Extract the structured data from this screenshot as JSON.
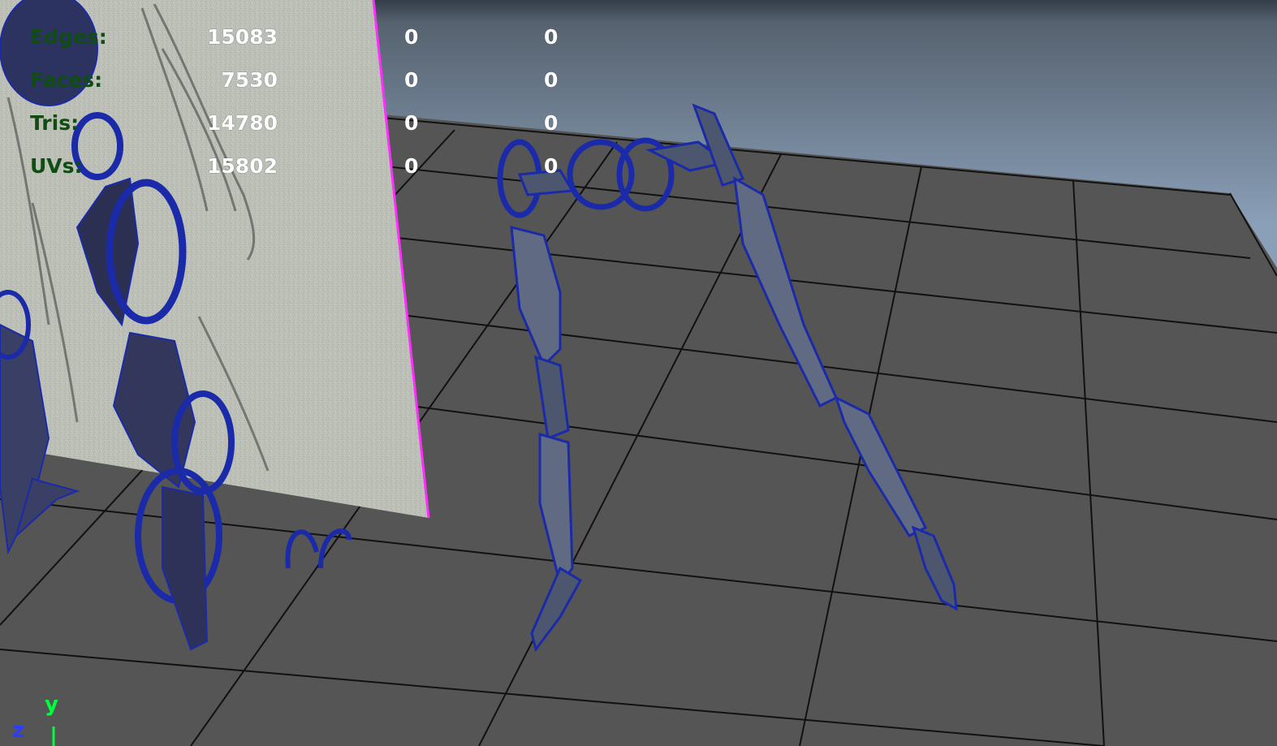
{
  "hud": {
    "rows": [
      {
        "label": "Edges:",
        "total": "15083",
        "selected": "0",
        "extra": "0"
      },
      {
        "label": "Faces:",
        "total": "7530",
        "selected": "0",
        "extra": "0"
      },
      {
        "label": "Tris:",
        "total": "14780",
        "selected": "0",
        "extra": "0"
      },
      {
        "label": "UVs:",
        "total": "15802",
        "selected": "0",
        "extra": "0"
      }
    ]
  },
  "axis_gizmo": {
    "y_label": "y",
    "z_label": "z",
    "y_color": "#00ff3a",
    "z_color": "#2a3cff"
  },
  "colors": {
    "sky_top": "#3a4350",
    "sky_bottom": "#8a9fb8",
    "ground": "#555555",
    "grid_line": "#111111",
    "wireframe": "#15209a",
    "image_plane": "#b9bdb4",
    "image_plane_border": "#ff2dff"
  }
}
